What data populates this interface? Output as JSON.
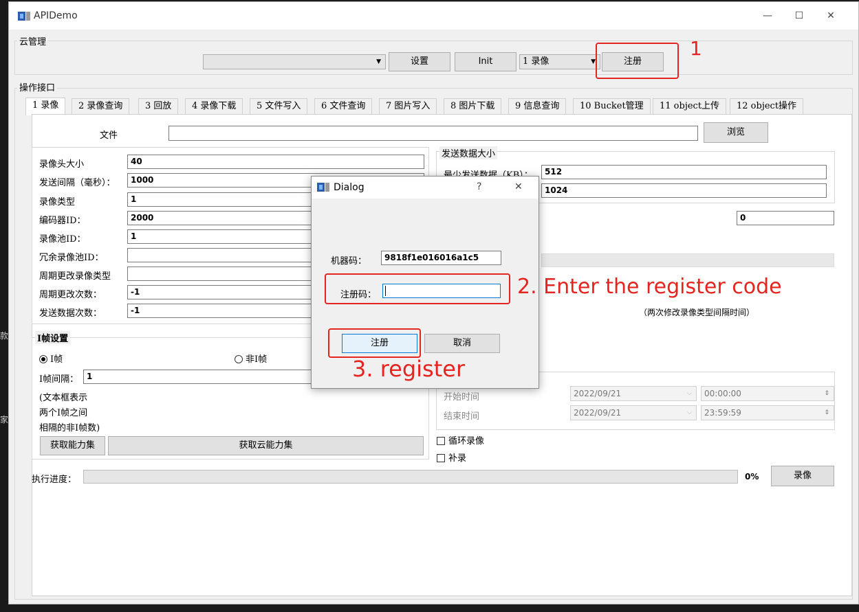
{
  "window": {
    "title": "APIDemo",
    "minimize": "—",
    "maximize": "☐",
    "close": "✕"
  },
  "cloud_group": {
    "title": "云管理",
    "settings_label": "设置",
    "init_label": "Init",
    "record_select": "1 录像",
    "register_label": "注册"
  },
  "ops_group": {
    "title": "操作接口"
  },
  "tabs": [
    "1 录像",
    "2 录像查询",
    "3 回放",
    "4 录像下载",
    "5 文件写入",
    "6 文件查询",
    "7 图片写入",
    "8 图片下载",
    "9 信息查询",
    "10 Bucket管理",
    "11 object上传",
    "12 object操作"
  ],
  "file": {
    "label": "文件",
    "value": "",
    "browse_label": "浏览"
  },
  "params": {
    "header_size_label": "录像头大小",
    "header_size": "40",
    "send_interval_label": "发送间隔（毫秒）：",
    "send_interval": "1000",
    "record_type_label": "录像类型",
    "record_type": "1",
    "encoder_id_label": "编码器ID：",
    "encoder_id": "2000",
    "pool_id_label": "录像池ID：",
    "pool_id": "1",
    "redundant_pool_label": "冗余录像池ID：",
    "redundant_pool": "",
    "period_change_type_label": "周期更改录像类型",
    "period_change_type": "",
    "period_change_count_label": "周期更改次数：",
    "period_change_count": "-1",
    "send_count_label": "发送数据次数：",
    "send_count": "-1"
  },
  "send_size": {
    "title": "发送数据大小",
    "min_label": "最少发送数据（KB）：",
    "min_value": "512",
    "max_value": "1024"
  },
  "extra_value": "0",
  "interval_note": "（两次修改录像类型间隔时间）",
  "iframe": {
    "title": "I帧设置",
    "iframe_label": "I帧",
    "non_iframe_label": "非I帧",
    "interval_label": "I帧间隔：",
    "interval_value": "1",
    "note1": "(文本框表示",
    "note2": "两个I帧之间",
    "note3": "相隔的非I帧数)"
  },
  "capability_button": "获取能力集",
  "cloud_capability_button": "获取云能力集",
  "time": {
    "start_label": "开始时间",
    "start_date": "2022/09/21",
    "start_time": "00:00:00",
    "end_label": "结束时间",
    "end_date": "2022/09/21",
    "end_time": "23:59:59"
  },
  "loop_record_label": "循环录像",
  "supplement_label": "补录",
  "progress": {
    "label": "执行进度：",
    "value": 0,
    "text": "0%",
    "record_button": "录像"
  },
  "dialog": {
    "title": "Dialog",
    "help": "?",
    "close": "✕",
    "machine_code_label": "机器码：",
    "machine_code": "9818f1e016016a1c5",
    "register_code_label": "注册码：",
    "register_code": "",
    "register_button": "注册",
    "cancel_button": "取消"
  },
  "annotations": {
    "step1": "1",
    "step2": "2. Enter the register code",
    "step3": "3. register",
    "color": "#e52420"
  },
  "background_fragments": {
    "left1": "款",
    "left2": "家"
  }
}
